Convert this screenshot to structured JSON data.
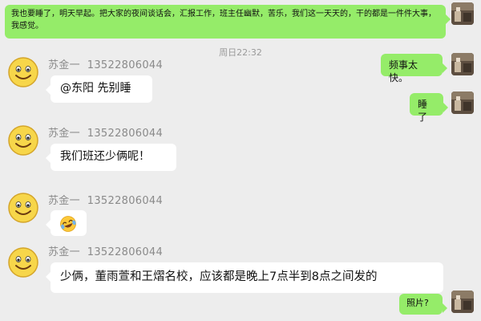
{
  "messages": {
    "top_message": "我也要睡了，明天早起。把大家的夜间谈话会，汇报工作，班主任幽默，苦乐，我们这一天天的，干的都是一件件大事，我感觉。",
    "timestamp": "周日22:32",
    "right_1": "频事太快。",
    "right_2": "睡了",
    "left_1": "@东阳 先别睡",
    "left_2": "我们班还少俩呢！",
    "left_3_emoji": "😂",
    "left_4": "少俩，董雨萱和王熠名校，应该都是晚上7点半到8点之间发的",
    "right_3": "照片?"
  },
  "sender": {
    "name": "苏金一",
    "phone": "13522806044"
  }
}
